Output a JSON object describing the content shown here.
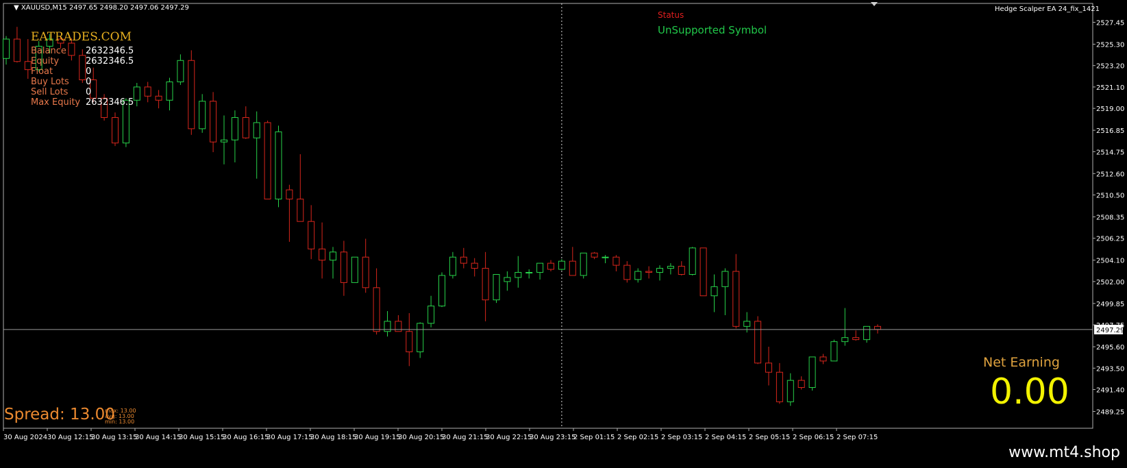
{
  "header": {
    "symbol_info": "XAUUSD,M15  2497.65 2498.20 2497.06 2497.29",
    "ea_name": "Hedge Scalper EA 24_fix_1421"
  },
  "status": {
    "label": "Status",
    "value": "UnSupported Symbol"
  },
  "panel": {
    "brand": "EATRADES.COM",
    "rows": [
      {
        "key": "Balance",
        "value": "2632346.5"
      },
      {
        "key": "Equity",
        "value": "2632346.5"
      },
      {
        "key": "Float",
        "value": "0"
      },
      {
        "key": "Buy Lots",
        "value": "0"
      },
      {
        "key": "Sell Lots",
        "value": "0"
      },
      {
        "key": "Max Equity",
        "value": "2632346.5"
      }
    ]
  },
  "spread": {
    "label": "Spread: 13.00",
    "max": "max:  13.00",
    "avg": "avg:  13.00",
    "min": "min:  13.00"
  },
  "net_earning": {
    "label": "Net Earning",
    "value": "0.00"
  },
  "footer": {
    "site": "www.mt4.shop"
  },
  "colors": {
    "up": "#27d34a",
    "down": "#d8261c",
    "grid": "#9a9a9a",
    "background": "#000000"
  },
  "chart_data": {
    "type": "candlestick",
    "title": "XAUUSD,M15",
    "ylim": [
      2487.6,
      2529.3
    ],
    "price_ticks": [
      "2527.45",
      "2525.30",
      "2523.20",
      "2521.10",
      "2519.00",
      "2516.85",
      "2514.75",
      "2512.60",
      "2510.50",
      "2508.35",
      "2506.25",
      "2504.10",
      "2502.00",
      "2499.85",
      "2497.75",
      "2495.60",
      "2493.50",
      "2491.40",
      "2489.25"
    ],
    "current_price": "2497.29",
    "time_labels": [
      "30 Aug 2024",
      "30 Aug 12:15",
      "30 Aug 13:15",
      "30 Aug 14:15",
      "30 Aug 15:15",
      "30 Aug 16:15",
      "30 Aug 17:15",
      "30 Aug 18:15",
      "30 Aug 19:15",
      "30 Aug 20:15",
      "30 Aug 21:15",
      "30 Aug 22:15",
      "30 Aug 23:15",
      "2 Sep 01:15",
      "2 Sep 02:15",
      "2 Sep 03:15",
      "2 Sep 04:15",
      "2 Sep 05:15",
      "2 Sep 06:15",
      "2 Sep 07:15"
    ],
    "crosshair_index": 51,
    "candles": [
      [
        2523.9,
        2526.1,
        2523.3,
        2525.8
      ],
      [
        2525.8,
        2527.0,
        2523.5,
        2523.6
      ],
      [
        2523.6,
        2525.8,
        2521.9,
        2522.8
      ],
      [
        2522.8,
        2525.6,
        2522.6,
        2525.1
      ],
      [
        2525.1,
        2526.3,
        2524.4,
        2525.8
      ],
      [
        2525.8,
        2526.1,
        2524.9,
        2525.4
      ],
      [
        2525.4,
        2525.9,
        2523.7,
        2524.2
      ],
      [
        2524.2,
        2524.8,
        2521.5,
        2521.8
      ],
      [
        2521.8,
        2523.0,
        2519.6,
        2520.0
      ],
      [
        2520.0,
        2520.4,
        2517.8,
        2518.1
      ],
      [
        2518.1,
        2518.6,
        2515.3,
        2515.6
      ],
      [
        2515.6,
        2520.0,
        2515.2,
        2519.8
      ],
      [
        2519.8,
        2521.5,
        2519.2,
        2521.1
      ],
      [
        2521.1,
        2521.6,
        2519.6,
        2520.2
      ],
      [
        2520.2,
        2520.8,
        2519.0,
        2519.8
      ],
      [
        2519.8,
        2522.0,
        2518.8,
        2521.6
      ],
      [
        2521.6,
        2524.3,
        2521.3,
        2523.7
      ],
      [
        2523.7,
        2524.7,
        2516.4,
        2517.0
      ],
      [
        2517.0,
        2520.4,
        2516.6,
        2519.7
      ],
      [
        2519.7,
        2520.6,
        2514.7,
        2515.7
      ],
      [
        2515.7,
        2518.3,
        2513.5,
        2515.9
      ],
      [
        2515.9,
        2518.8,
        2513.7,
        2518.1
      ],
      [
        2518.1,
        2519.2,
        2516.0,
        2516.1
      ],
      [
        2516.1,
        2518.7,
        2512.1,
        2517.6
      ],
      [
        2517.6,
        2517.8,
        2512.2,
        2510.1
      ],
      [
        2510.1,
        2517.3,
        2509.3,
        2516.7
      ],
      [
        2511.0,
        2511.5,
        2505.9,
        2510.1
      ],
      [
        2510.1,
        2514.5,
        2508.6,
        2507.9
      ],
      [
        2507.9,
        2509.5,
        2504.2,
        2505.2
      ],
      [
        2505.2,
        2507.8,
        2502.3,
        2504.1
      ],
      [
        2504.1,
        2505.4,
        2502.3,
        2504.9
      ],
      [
        2504.9,
        2506.0,
        2500.6,
        2501.9
      ],
      [
        2501.9,
        2504.3,
        2502.0,
        2504.4
      ],
      [
        2504.4,
        2506.2,
        2500.9,
        2501.4
      ],
      [
        2501.4,
        2503.3,
        2496.8,
        2497.1
      ],
      [
        2497.1,
        2499.1,
        2496.6,
        2498.1
      ],
      [
        2498.1,
        2498.7,
        2497.8,
        2497.1
      ],
      [
        2497.1,
        2498.9,
        2493.7,
        2495.1
      ],
      [
        2495.1,
        2498.0,
        2494.5,
        2497.9
      ],
      [
        2497.9,
        2500.6,
        2497.5,
        2499.6
      ],
      [
        2499.6,
        2502.9,
        2499.5,
        2502.6
      ],
      [
        2502.6,
        2504.9,
        2502.3,
        2504.4
      ],
      [
        2504.4,
        2505.3,
        2503.3,
        2503.8
      ],
      [
        2503.8,
        2504.3,
        2502.5,
        2503.3
      ],
      [
        2503.3,
        2504.9,
        2498.1,
        2500.2
      ],
      [
        2500.2,
        2502.5,
        2499.9,
        2502.7
      ],
      [
        2502.0,
        2503.0,
        2501.1,
        2502.4
      ],
      [
        2502.4,
        2504.5,
        2501.4,
        2502.9
      ],
      [
        2502.9,
        2503.2,
        2502.3,
        2502.9
      ],
      [
        2502.9,
        2503.3,
        2502.2,
        2503.8
      ],
      [
        2503.8,
        2504.1,
        2503.0,
        2503.2
      ],
      [
        2503.2,
        2504.2,
        2503.1,
        2504.0
      ],
      [
        2504.0,
        2505.4,
        2503.7,
        2502.6
      ],
      [
        2502.6,
        2504.8,
        2502.3,
        2504.8
      ],
      [
        2504.8,
        2504.9,
        2504.2,
        2504.4
      ],
      [
        2504.4,
        2504.6,
        2503.8,
        2504.4
      ],
      [
        2504.4,
        2504.6,
        2503.0,
        2503.6
      ],
      [
        2503.6,
        2504.0,
        2501.9,
        2502.2
      ],
      [
        2502.2,
        2503.3,
        2501.9,
        2503.0
      ],
      [
        2503.0,
        2503.5,
        2502.3,
        2502.9
      ],
      [
        2502.9,
        2503.6,
        2502.1,
        2503.3
      ],
      [
        2503.3,
        2503.8,
        2502.7,
        2503.5
      ],
      [
        2503.5,
        2504.0,
        2502.6,
        2502.7
      ],
      [
        2502.7,
        2505.4,
        2502.6,
        2505.3
      ],
      [
        2505.3,
        2505.3,
        2500.8,
        2500.6
      ],
      [
        2500.6,
        2502.7,
        2499.0,
        2501.5
      ],
      [
        2501.5,
        2503.3,
        2498.7,
        2503.0
      ],
      [
        2503.0,
        2504.7,
        2497.4,
        2497.6
      ],
      [
        2497.6,
        2499.0,
        2497.0,
        2498.1
      ],
      [
        2498.1,
        2498.6,
        2493.9,
        2494.0
      ],
      [
        2494.0,
        2495.6,
        2491.8,
        2493.1
      ],
      [
        2493.1,
        2494.0,
        2490.0,
        2490.2
      ],
      [
        2490.2,
        2493.0,
        2489.8,
        2492.3
      ],
      [
        2492.3,
        2492.7,
        2491.4,
        2491.6
      ],
      [
        2491.6,
        2493.5,
        2491.3,
        2494.6
      ],
      [
        2494.6,
        2494.9,
        2493.9,
        2494.2
      ],
      [
        2494.2,
        2496.3,
        2494.4,
        2496.1
      ],
      [
        2496.1,
        2499.4,
        2495.7,
        2496.5
      ],
      [
        2496.5,
        2497.2,
        2496.2,
        2496.3
      ],
      [
        2496.3,
        2497.5,
        2496.0,
        2497.6
      ],
      [
        2497.6,
        2497.8,
        2496.9,
        2497.3
      ]
    ]
  }
}
